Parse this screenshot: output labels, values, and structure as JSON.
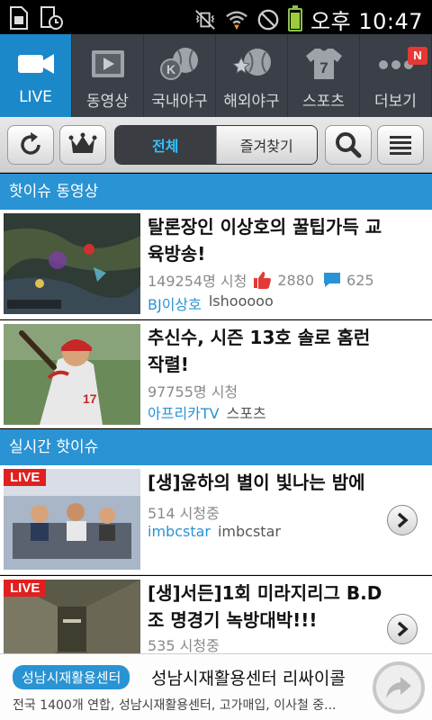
{
  "status_bar": {
    "time": "오후 10:47",
    "icons": [
      "sim-card-icon",
      "screenshot-clock-icon",
      "vibrate-muted-icon",
      "wifi-icon",
      "no-signal-icon",
      "battery-icon"
    ]
  },
  "nav": {
    "tabs": [
      {
        "label": "LIVE",
        "icon": "video-camera-icon",
        "active": true
      },
      {
        "label": "동영상",
        "icon": "video-play-icon"
      },
      {
        "label": "국내야구",
        "icon": "baseball-k-icon"
      },
      {
        "label": "해외야구",
        "icon": "baseball-star-icon"
      },
      {
        "label": "스포츠",
        "icon": "jersey-7-icon"
      },
      {
        "label": "더보기",
        "icon": "more-dots-icon",
        "badge": "N"
      }
    ]
  },
  "toolbar": {
    "segments": [
      "전체",
      "즐겨찾기"
    ],
    "selected_segment": "전체"
  },
  "sections": {
    "hot_videos": "핫이슈 동영상",
    "live_hot": "실시간 핫이슈"
  },
  "hot_videos": [
    {
      "title": "탈론장인 이상호의 꿀팁가득 교육방송!",
      "views": "149254명 시청",
      "likes": "2880",
      "comments": "625",
      "channel": "BJ이상호",
      "channel_id": "lshooooo"
    },
    {
      "title": "추신수, 시즌 13호 솔로 홈런 작렬!",
      "views": "97755명 시청",
      "channel": "아프리카TV",
      "channel_id": "스포츠"
    }
  ],
  "live_items": [
    {
      "badge": "LIVE",
      "title": "[생]윤하의 별이 빛나는 밤에",
      "viewers": "514 시청중",
      "channel": "imbcstar",
      "channel_id": "imbcstar"
    },
    {
      "badge": "LIVE",
      "title": "[생]서든]1회 미라지리그 B.D조 명경기 녹방대박!!!",
      "viewers": "535 시청중"
    }
  ],
  "ad": {
    "tag": "성남시재활용센터",
    "title": "성남시재활용센터 리싸이콜",
    "desc": "전국 1400개 연합, 성남시재활용센터, 고가매입, 이사철 중..."
  },
  "colors": {
    "accent": "#1a88c9",
    "section_blue": "#2a93d3",
    "nav_bg": "#3b3f47",
    "live_red": "#e02020",
    "like_red": "#e53935"
  }
}
